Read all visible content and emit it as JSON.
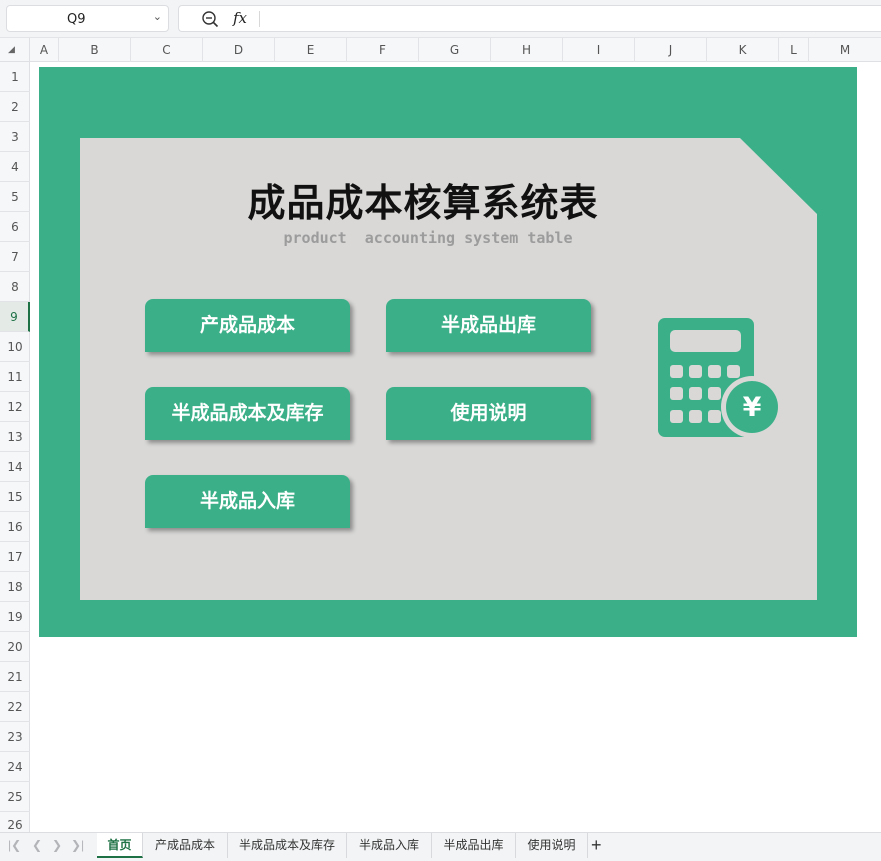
{
  "formula_bar": {
    "cell_ref": "Q9",
    "formula": "",
    "fx_label": "fx"
  },
  "columns": [
    "A",
    "B",
    "C",
    "D",
    "E",
    "F",
    "G",
    "H",
    "I",
    "J",
    "K",
    "L",
    "M"
  ],
  "rows": [
    "1",
    "2",
    "3",
    "4",
    "5",
    "6",
    "7",
    "8",
    "9",
    "10",
    "11",
    "12",
    "13",
    "14",
    "15",
    "16",
    "17",
    "18",
    "19",
    "20",
    "21",
    "22",
    "23",
    "24",
    "25",
    "26"
  ],
  "selected_row": "9",
  "dashboard": {
    "title": "成品成本核算系统表",
    "subtitle": "product  accounting system table",
    "buttons": [
      {
        "label": "产成品成本"
      },
      {
        "label": "半成品出库"
      },
      {
        "label": "半成品成本及库存"
      },
      {
        "label": "使用说明"
      },
      {
        "label": "半成品入库"
      }
    ],
    "calculator_symbol": "¥",
    "icon": "calculator-yen-icon",
    "colors": {
      "frame_green": "#3bb088",
      "panel_gray": "#d9d8d7"
    }
  },
  "sheet_tabs": [
    {
      "label": "首页",
      "active": true
    },
    {
      "label": "产成品成本",
      "active": false
    },
    {
      "label": "半成品成本及库存",
      "active": false
    },
    {
      "label": "半成品入库",
      "active": false
    },
    {
      "label": "半成品出库",
      "active": false
    },
    {
      "label": "使用说明",
      "active": false
    }
  ],
  "tab_add_label": "+"
}
